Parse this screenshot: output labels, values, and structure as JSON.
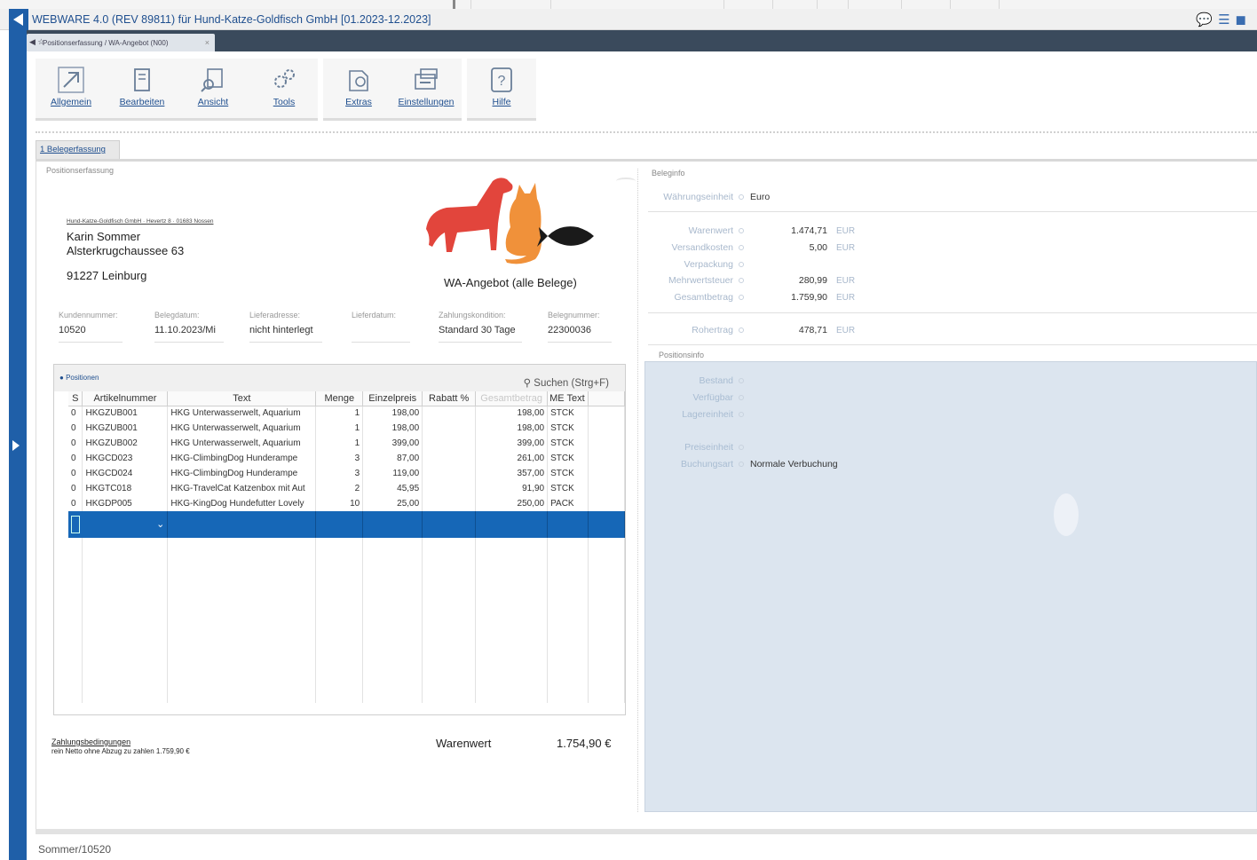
{
  "window": {
    "title": "WEBWARE 4.0 (REV 89811) für Hund-Katze-Goldfisch GmbH   [01.2023-12.2023]"
  },
  "doc_tab": {
    "label": "Positionserfassung / WA-Angebot (N00)",
    "close": "×"
  },
  "toolbar": {
    "allgemein": "Allgemein",
    "bearbeiten": "Bearbeiten",
    "ansicht": "Ansicht",
    "tools": "Tools",
    "extras": "Extras",
    "einstellungen": "Einstellungen",
    "hilfe": "Hilfe"
  },
  "section_tab": "1 Belegerfassung",
  "left": {
    "panel_label": "Positionserfassung",
    "sender_line": "Hund-Katze-Goldfisch GmbH · Hevertz 8 · 01683 Nossen",
    "recipient_name": "Karin Sommer",
    "recipient_street": "Alsterkrugchaussee 63",
    "recipient_city": "91227 Leinburg",
    "doc_title": "WA-Angebot (alle Belege)",
    "fields": {
      "kundennummer_label": "Kundennummer:",
      "kundennummer": "10520",
      "belegdatum_label": "Belegdatum:",
      "belegdatum": "11.10.2023/Mi",
      "lieferadresse_label": "Lieferadresse:",
      "lieferadresse": "nicht hinterlegt",
      "lieferdatum_label": "Lieferdatum:",
      "lieferdatum": "",
      "zahlungskondition_label": "Zahlungskondition:",
      "zahlungskondition": "Standard 30 Tage",
      "belegnummer_label": "Belegnummer:",
      "belegnummer": "22300036"
    },
    "positions_title": "Positionen",
    "search_label": "Suchen (Strg+F)",
    "columns": [
      "S",
      "Artikelnummer",
      "Text",
      "Menge",
      "Einzelpreis",
      "Rabatt %",
      "Gesamtbetrag",
      "ME Text"
    ],
    "rows": [
      {
        "s": "0",
        "art": "HKGZUB001",
        "text": "HKG Unterwasserwelt, Aquarium",
        "menge": "1",
        "preis": "198,00",
        "rabatt": "",
        "gesamt": "198,00",
        "me": "STCK"
      },
      {
        "s": "0",
        "art": "HKGZUB001",
        "text": "HKG Unterwasserwelt, Aquarium",
        "menge": "1",
        "preis": "198,00",
        "rabatt": "",
        "gesamt": "198,00",
        "me": "STCK"
      },
      {
        "s": "0",
        "art": "HKGZUB002",
        "text": "HKG Unterwasserwelt, Aquarium",
        "menge": "1",
        "preis": "399,00",
        "rabatt": "",
        "gesamt": "399,00",
        "me": "STCK"
      },
      {
        "s": "0",
        "art": "HKGCD023",
        "text": "HKG-ClimbingDog Hunderampe",
        "menge": "3",
        "preis": "87,00",
        "rabatt": "",
        "gesamt": "261,00",
        "me": "STCK"
      },
      {
        "s": "0",
        "art": "HKGCD024",
        "text": "HKG-ClimbingDog Hunderampe",
        "menge": "3",
        "preis": "119,00",
        "rabatt": "",
        "gesamt": "357,00",
        "me": "STCK"
      },
      {
        "s": "0",
        "art": "HKGTC018",
        "text": "HKG-TravelCat Katzenbox mit Aut",
        "menge": "2",
        "preis": "45,95",
        "rabatt": "",
        "gesamt": "91,90",
        "me": "STCK"
      },
      {
        "s": "0",
        "art": "HKGDP005",
        "text": "HKG-KingDog Hundefutter Lovely",
        "menge": "10",
        "preis": "25,00",
        "rabatt": "",
        "gesamt": "250,00",
        "me": "PACK"
      }
    ],
    "zahlungsbedingungen_label": "Zahlungsbedingungen",
    "zahlungsbedingungen_text": "rein Netto ohne Abzug zu zahlen 1.759,90 €",
    "warenwert_label": "Warenwert",
    "warenwert_value": "1.754,90 €"
  },
  "right": {
    "beleginfo_label": "Beleginfo",
    "waehrung_label": "Währungseinheit",
    "waehrung": "Euro",
    "totals": [
      {
        "label": "Warenwert",
        "value": "1.474,71",
        "cur": "EUR"
      },
      {
        "label": "Versandkosten",
        "value": "5,00",
        "cur": "EUR"
      },
      {
        "label": "Verpackung",
        "value": "",
        "cur": ""
      },
      {
        "label": "Mehrwertsteuer",
        "value": "280,99",
        "cur": "EUR"
      },
      {
        "label": "Gesamtbetrag",
        "value": "1.759,90",
        "cur": "EUR"
      }
    ],
    "rohertrag_label": "Rohertrag",
    "rohertrag": "478,71",
    "rohertrag_cur": "EUR",
    "positionsinfo_label": "Positionsinfo",
    "posinfo": {
      "bestand": "Bestand",
      "verfuegbar": "Verfügbar",
      "lagereinheit": "Lagereinheit",
      "preiseinheit": "Preiseinheit",
      "buchungsart_label": "Buchungsart",
      "buchungsart": "Normale Verbuchung"
    }
  },
  "status": "Sommer/10520",
  "colors": {
    "accent": "#1f5fa8",
    "selection": "#1667b7",
    "dog": "#e2453c",
    "cat": "#f0913a",
    "fish": "#1a1a1a"
  }
}
